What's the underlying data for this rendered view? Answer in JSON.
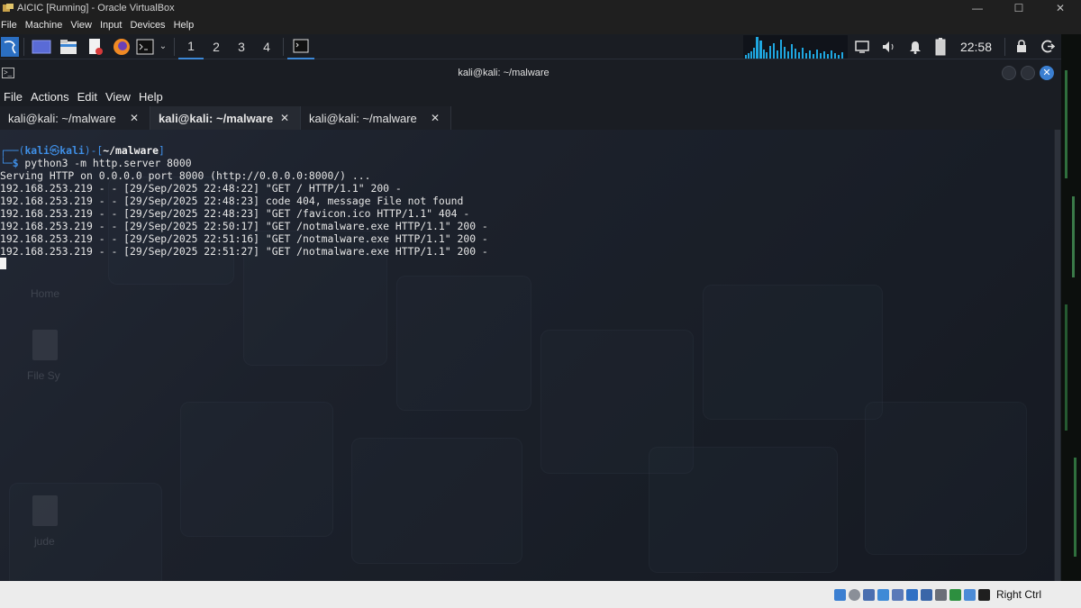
{
  "window": {
    "title": "AICIC [Running] - Oracle VirtualBox",
    "controls": [
      "—",
      "☐",
      "✕"
    ]
  },
  "vbox_menu": [
    "File",
    "Machine",
    "View",
    "Input",
    "Devices",
    "Help"
  ],
  "panel": {
    "workspaces": [
      "1",
      "2",
      "3",
      "4"
    ],
    "clock": "22:58"
  },
  "terminal": {
    "title": "kali@kali: ~/malware",
    "menu": [
      "File",
      "Actions",
      "Edit",
      "View",
      "Help"
    ],
    "tabs": [
      {
        "label": "kali@kali: ~/malware",
        "close": "✕"
      },
      {
        "label": "kali@kali: ~/malware",
        "close": "✕"
      },
      {
        "label": "kali@kali: ~/malware",
        "close": "✕"
      }
    ],
    "prompt": {
      "corner_top": "┌──(",
      "user": "kali",
      "at": "㉿",
      "host": "kali",
      "mid": ")-[",
      "path": "~/malware",
      "end": "]",
      "corner_bottom": "└─",
      "dollar": "$",
      "command": " python3 -m http.server 8000"
    },
    "output": [
      "Serving HTTP on 0.0.0.0 port 8000 (http://0.0.0.0:8000/) ...",
      "192.168.253.219 - - [29/Sep/2025 22:48:22] \"GET / HTTP/1.1\" 200 -",
      "192.168.253.219 - - [29/Sep/2025 22:48:23] code 404, message File not found",
      "192.168.253.219 - - [29/Sep/2025 22:48:23] \"GET /favicon.ico HTTP/1.1\" 404 -",
      "192.168.253.219 - - [29/Sep/2025 22:50:17] \"GET /notmalware.exe HTTP/1.1\" 200 -",
      "192.168.253.219 - - [29/Sep/2025 22:51:16] \"GET /notmalware.exe HTTP/1.1\" 200 -",
      "192.168.253.219 - - [29/Sep/2025 22:51:27] \"GET /notmalware.exe HTTP/1.1\" 200 -"
    ]
  },
  "desktop_labels": [
    "Home",
    "File Sy",
    "jude"
  ],
  "statusbar": {
    "host_key": "Right Ctrl"
  },
  "colors": {
    "accent": "#3f8fe6",
    "panel_bg": "#1a1d23",
    "terminal_text": "#e6e6e6"
  }
}
